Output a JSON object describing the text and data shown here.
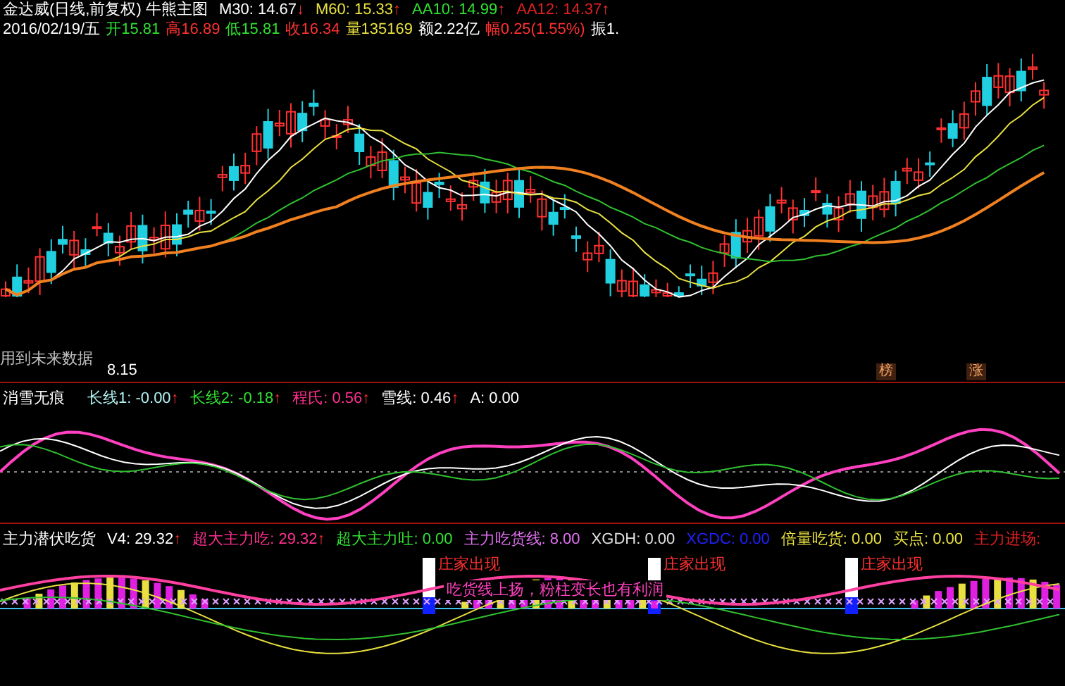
{
  "main_chart": {
    "title": "金达威(日线,前复权) 牛熊主图",
    "indicators": [
      {
        "text": "M30: 14.67",
        "color": "#ffffff",
        "arrow": "↓"
      },
      {
        "text": "M60: 15.33",
        "color": "#e8e040",
        "arrow": "↑"
      },
      {
        "text": "AA10: 14.99",
        "color": "#30e030",
        "arrow": "↑"
      },
      {
        "text": "AA12: 14.37",
        "color": "#e02020",
        "arrow": "↑"
      }
    ],
    "quote": [
      {
        "text": "2016/02/19/五",
        "color": "#ffffff"
      },
      {
        "text": "开15.81",
        "color": "#30e030"
      },
      {
        "text": "高16.89",
        "color": "#ff3030"
      },
      {
        "text": "低15.81",
        "color": "#30e030"
      },
      {
        "text": "收16.34",
        "color": "#ff3030"
      },
      {
        "text": "量135169",
        "color": "#e8e040"
      },
      {
        "text": "额2.22亿",
        "color": "#ffffff"
      },
      {
        "text": "幅0.25(1.55%)",
        "color": "#ff3030"
      },
      {
        "text": "振1.",
        "color": "#ffffff"
      }
    ],
    "note": "用到未来数据",
    "low_label": "8.15",
    "tags": [
      "榜",
      "涨"
    ]
  },
  "indicator_1": {
    "name": "消雪无痕",
    "values": [
      {
        "text": "长线1: -0.00",
        "color": "#b0f0f0",
        "arrow": "↑"
      },
      {
        "text": "长线2: -0.18",
        "color": "#30e030",
        "arrow": "↑"
      },
      {
        "text": "程氏: 0.56",
        "color": "#ff3090",
        "arrow": "↑"
      },
      {
        "text": "雪线: 0.46",
        "color": "#ffffff",
        "arrow": "↑"
      },
      {
        "text": "A: 0.00",
        "color": "#ffffff"
      }
    ]
  },
  "indicator_2": {
    "name": "主力潜伏吃货",
    "values": [
      {
        "text": "V4: 29.32",
        "color": "#ffffff",
        "arrow": "↑"
      },
      {
        "text": "超大主力吃: 29.32",
        "color": "#ff3090",
        "arrow": "↑"
      },
      {
        "text": "超大主力吐: 0.00",
        "color": "#30e030"
      },
      {
        "text": "主力吃货线: 8.00",
        "color": "#e070f0"
      },
      {
        "text": "XGDH: 0.00",
        "color": "#e0e0e0"
      },
      {
        "text": "XGDC: 0.00",
        "color": "#2020ff"
      },
      {
        "text": "倍量吃货: 0.00",
        "color": "#e8e040"
      },
      {
        "text": "买点: 0.00",
        "color": "#e8e040"
      },
      {
        "text": "主力进场:",
        "color": "#e02020"
      }
    ],
    "signals": [
      "庄家出现",
      "庄家出现",
      "庄家出现"
    ],
    "hint": "吃货线上扬，粉柱变长也有利润"
  }
}
